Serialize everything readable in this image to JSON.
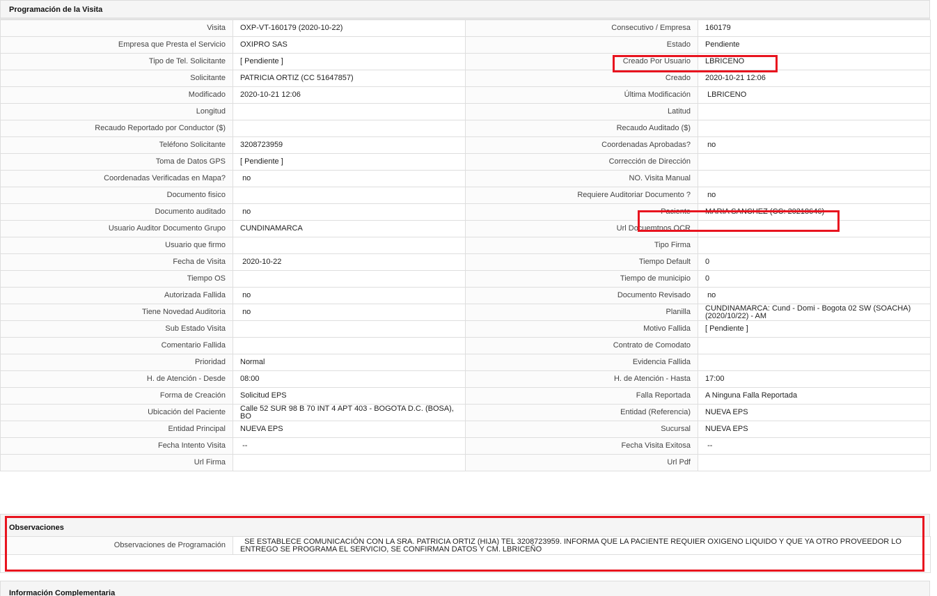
{
  "programacion": {
    "title": "Programación de la Visita",
    "rows": [
      {
        "l1": "Visita",
        "v1": "OXP-VT-160179 (2020-10-22)",
        "l2": "Consecutivo / Empresa",
        "v2": "160179"
      },
      {
        "l1": "Empresa que Presta el Servicio",
        "v1": "OXIPRO SAS",
        "l2": "Estado",
        "v2": "Pendiente"
      },
      {
        "l1": "Tipo de Tel. Solicitante",
        "v1": "[ Pendiente ]",
        "l2": "Creado Por Usuario",
        "v2": "LBRICENO"
      },
      {
        "l1": "Solicitante",
        "v1": "PATRICIA ORTIZ (CC 51647857)",
        "l2": "Creado",
        "v2": "2020-10-21 12:06"
      },
      {
        "l1": "Modificado",
        "v1": "2020-10-21 12:06",
        "l2": "Última Modificación",
        "v2": " LBRICENO"
      },
      {
        "l1": "Longitud",
        "v1": "",
        "l2": "Latitud",
        "v2": ""
      },
      {
        "l1": "Recaudo Reportado por Conductor ($)",
        "v1": "",
        "l2": "Recaudo Auditado ($)",
        "v2": ""
      },
      {
        "l1": "Teléfono Solicitante",
        "v1": "3208723959",
        "l2": "Coordenadas Aprobadas?",
        "v2": " no"
      },
      {
        "l1": "Toma de Datos GPS",
        "v1": "[ Pendiente ]",
        "l2": "Corrección de Dirección",
        "v2": ""
      },
      {
        "l1": "Coordenadas Verificadas en Mapa?",
        "v1": " no",
        "l2": "NO. Visita Manual",
        "v2": ""
      },
      {
        "l1": "Documento fisico",
        "v1": "",
        "l2": "Requiere Auditoriar Documento ?",
        "v2": " no"
      },
      {
        "l1": "Documento auditado",
        "v1": " no",
        "l2": "Paciente",
        "v2": "MARIA SANCHEZ (CC: 20218646)"
      },
      {
        "l1": "Usuario Auditor Documento Grupo",
        "v1": "CUNDINAMARCA",
        "l2": "Url Docuemtnos OCR",
        "v2": ""
      },
      {
        "l1": "Usuario que firmo",
        "v1": "",
        "l2": "Tipo Firma",
        "v2": ""
      },
      {
        "l1": "Fecha de Visita",
        "v1": " 2020-10-22",
        "l2": "Tiempo Default",
        "v2": "0"
      },
      {
        "l1": "Tiempo OS",
        "v1": "",
        "l2": "Tiempo de municipio",
        "v2": "0"
      },
      {
        "l1": "Autorizada Fallida",
        "v1": " no",
        "l2": "Documento Revisado",
        "v2": " no"
      },
      {
        "l1": "Tiene Novedad Auditoria",
        "v1": " no",
        "l2": "Planilla",
        "v2": "CUNDINAMARCA: Cund - Domi - Bogota 02 SW (SOACHA) (2020/10/22) - AM"
      },
      {
        "l1": "Sub Estado Visita",
        "v1": "",
        "l2": "Motivo Fallida",
        "v2": "[ Pendiente ]"
      },
      {
        "l1": "Comentario Fallida",
        "v1": "",
        "l2": "Contrato de Comodato",
        "v2": ""
      },
      {
        "l1": "Prioridad",
        "v1": "Normal",
        "l2": "Evidencia Fallida",
        "v2": ""
      },
      {
        "l1": "H. de Atención - Desde",
        "v1": "08:00",
        "l2": "H. de Atención - Hasta",
        "v2": "17:00"
      },
      {
        "l1": "Forma de Creación",
        "v1": "Solicitud EPS",
        "l2": "Falla Reportada",
        "v2": "A Ninguna Falla Reportada"
      },
      {
        "l1": "Ubicación del Paciente",
        "v1": "Calle 52 SUR 98 B 70 INT 4 APT 403 - BOGOTA D.C. (BOSA), BO",
        "l2": "Entidad (Referencia)",
        "v2": "NUEVA EPS"
      },
      {
        "l1": "Entidad Principal",
        "v1": "NUEVA EPS",
        "l2": "Sucursal",
        "v2": "NUEVA EPS"
      },
      {
        "l1": "Fecha Intento Visita",
        "v1": " --",
        "l2": "Fecha Visita Exitosa",
        "v2": " --"
      },
      {
        "l1": "Url Firma",
        "v1": "",
        "l2": "Url Pdf",
        "v2": ""
      }
    ]
  },
  "observaciones": {
    "title": "Observaciones",
    "label": "Observaciones de Programación",
    "value": "  SE ESTABLECE COMUNICACIÓN CON LA SRA. PATRICIA ORTIZ (HIJA) TEL 3208723959. INFORMA QUE LA PACIENTE REQUIER OXIGENO LIQUIDO Y QUE YA OTRO PROVEEDOR LO ENTREGO SE PROGRAMA EL SERVICIO, SE CONFIRMAN DATOS Y CM. LBRICEÑO"
  },
  "complementaria": {
    "title": "Información Complementaria"
  },
  "highlight_color": "#e8141f"
}
